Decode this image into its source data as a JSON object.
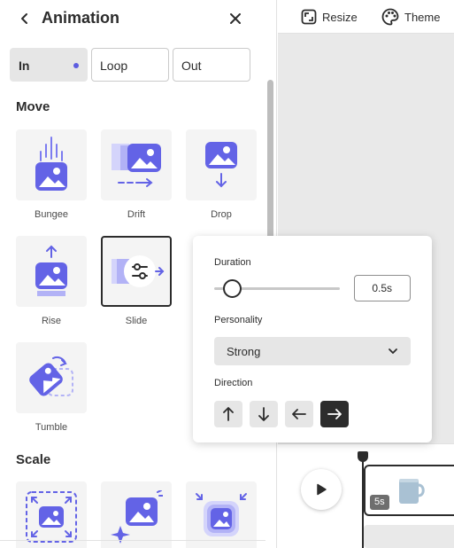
{
  "panel": {
    "title": "Animation",
    "tabs": [
      {
        "label": "In",
        "active": true
      },
      {
        "label": "Loop",
        "active": false
      },
      {
        "label": "Out",
        "active": false
      }
    ]
  },
  "sections": {
    "move": {
      "title": "Move",
      "items": [
        {
          "label": "Bungee",
          "icon": "bungee-icon"
        },
        {
          "label": "Drift",
          "icon": "drift-icon"
        },
        {
          "label": "Drop",
          "icon": "drop-icon"
        },
        {
          "label": "Rise",
          "icon": "rise-icon"
        },
        {
          "label": "Slide",
          "icon": "slide-icon",
          "selected": true
        },
        {
          "label": "Tumble",
          "icon": "tumble-icon"
        }
      ]
    },
    "scale": {
      "title": "Scale",
      "items": [
        {
          "icon": "scale-in-icon"
        },
        {
          "icon": "pop-icon"
        },
        {
          "icon": "zoom-icon"
        }
      ]
    }
  },
  "topbar": {
    "resize_label": "Resize",
    "theme_label": "Theme"
  },
  "popover": {
    "duration_label": "Duration",
    "duration_value": "0.5s",
    "personality_label": "Personality",
    "personality_value": "Strong",
    "direction_label": "Direction",
    "directions": [
      "up",
      "down",
      "left",
      "right"
    ],
    "active_direction": "right"
  },
  "timeline": {
    "clip_duration": "5s"
  },
  "colors": {
    "accent": "#5c5ce0",
    "accent_light": "#7b7bf0",
    "selected_dark": "#2c2c2c"
  }
}
